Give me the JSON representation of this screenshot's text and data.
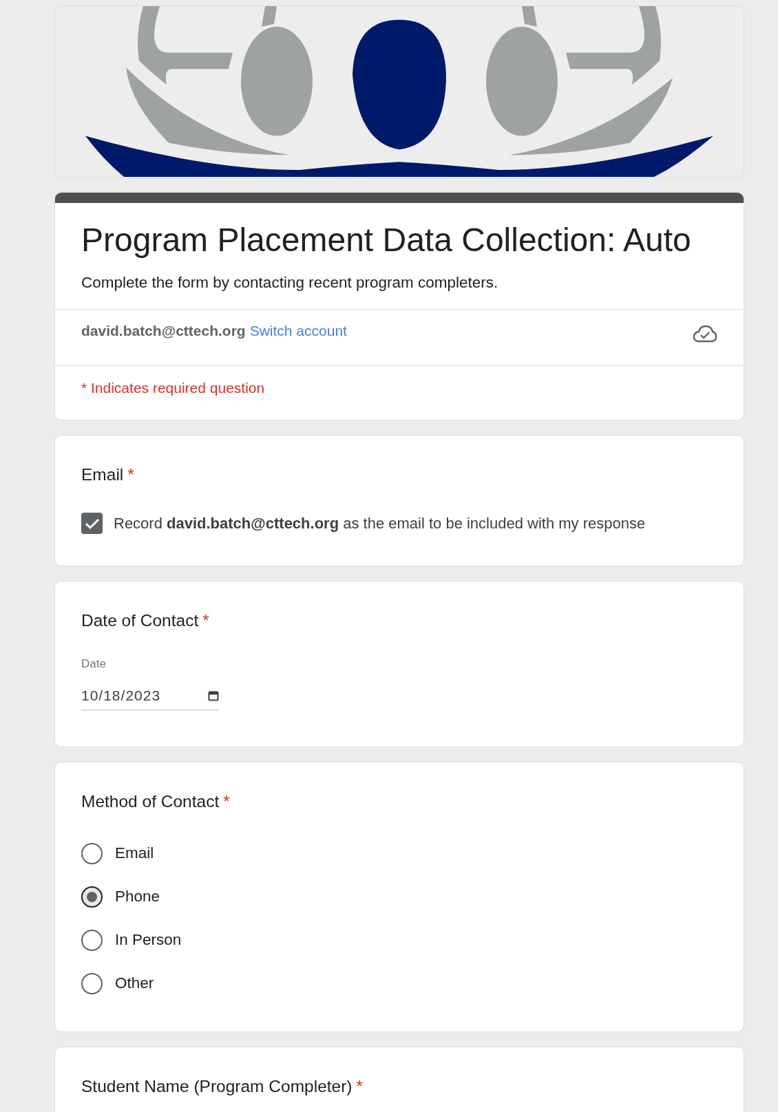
{
  "form": {
    "title": "Program Placement Data Collection: Auto",
    "description": "Complete the form by contacting recent program completers.",
    "account_email": "david.batch@cttech.org",
    "switch_link": "Switch account",
    "required_note": "* Indicates required question"
  },
  "questions": [
    {
      "kind": "checkbox",
      "title": "Email",
      "asterisk": "*",
      "label": "Record **david.batch@cttech.org** as the email to be included with my response",
      "checked": true
    },
    {
      "kind": "date",
      "title": "Date of Contact",
      "asterisk": "*",
      "field_label": "Date",
      "value": "10/18/2023"
    },
    {
      "kind": "radio",
      "title": "Method of Contact",
      "asterisk": "*",
      "options": [
        {
          "label": "Email",
          "selected": false
        },
        {
          "label": "Phone",
          "selected": true
        },
        {
          "label": "In Person",
          "selected": false
        },
        {
          "label": "Other",
          "selected": false
        }
      ]
    },
    {
      "kind": "text",
      "title": "Student Name (Program Completer)",
      "asterisk": "*"
    }
  ]
}
